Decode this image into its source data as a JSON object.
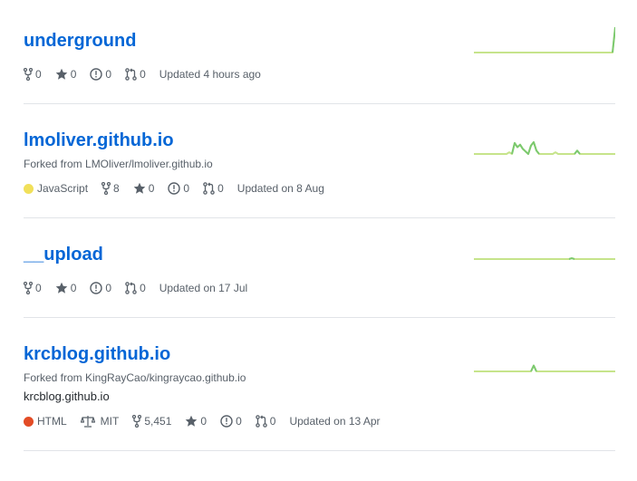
{
  "colors": {
    "link": "#0366d6",
    "text_muted": "#586069",
    "spark_line": "#c6e48b",
    "spark_dark": "#7bc96f",
    "lang_javascript": "#f1e05a",
    "lang_html": "#e34c26"
  },
  "repos": [
    {
      "name": "underground",
      "forks": "0",
      "stars": "0",
      "issues": "0",
      "pulls": "0",
      "updated": "Updated 4 hours ago",
      "activity": [
        0,
        0,
        0,
        0,
        0,
        0,
        0,
        0,
        0,
        0,
        0,
        0,
        0,
        0,
        0,
        0,
        0,
        0,
        0,
        0,
        0,
        0,
        0,
        0,
        0,
        0,
        0,
        0,
        0,
        0,
        0,
        0,
        0,
        0,
        0,
        0,
        0,
        0,
        0,
        0,
        0,
        0,
        0,
        0,
        0,
        0,
        0,
        0,
        0,
        0,
        0,
        0,
        30
      ]
    },
    {
      "name": "lmoliver.github.io",
      "forked_from": "Forked from LMOliver/lmoliver.github.io",
      "language": "JavaScript",
      "forks": "8",
      "stars": "0",
      "issues": "0",
      "pulls": "0",
      "updated": "Updated on 8 Aug",
      "activity": [
        0,
        0,
        0,
        0,
        0,
        0,
        0,
        0,
        0,
        0,
        0,
        0,
        0,
        2,
        0,
        13,
        8,
        11,
        6,
        3,
        0,
        10,
        14,
        4,
        0,
        0,
        0,
        0,
        0,
        0,
        2,
        0,
        0,
        0,
        0,
        0,
        0,
        0,
        4,
        0,
        0,
        0,
        0,
        0,
        0,
        0,
        0,
        0,
        0,
        0,
        0,
        0,
        0
      ]
    },
    {
      "name": "__upload",
      "forks": "0",
      "stars": "0",
      "issues": "0",
      "pulls": "0",
      "updated": "Updated on 17 Jul",
      "activity": [
        0,
        0,
        0,
        0,
        0,
        0,
        0,
        0,
        0,
        0,
        0,
        0,
        0,
        0,
        0,
        0,
        0,
        0,
        0,
        0,
        0,
        0,
        0,
        0,
        0,
        0,
        0,
        0,
        0,
        0,
        0,
        0,
        0,
        0,
        0,
        0,
        1,
        0,
        0,
        0,
        0,
        0,
        0,
        0,
        0,
        0,
        0,
        0,
        0,
        0,
        0,
        0,
        0
      ]
    },
    {
      "name": "krcblog.github.io",
      "forked_from": "Forked from KingRayCao/kingraycao.github.io",
      "description": "krcblog.github.io",
      "language": "HTML",
      "license": "MIT",
      "forks": "5,451",
      "stars": "0",
      "issues": "0",
      "pulls": "0",
      "updated": "Updated on 13 Apr",
      "activity": [
        0,
        0,
        0,
        0,
        0,
        0,
        0,
        0,
        0,
        0,
        0,
        0,
        0,
        0,
        0,
        0,
        0,
        0,
        0,
        0,
        0,
        0,
        7,
        0,
        0,
        0,
        0,
        0,
        0,
        0,
        0,
        0,
        0,
        0,
        0,
        0,
        0,
        0,
        0,
        0,
        0,
        0,
        0,
        0,
        0,
        0,
        0,
        0,
        0,
        0,
        0,
        0,
        0
      ]
    }
  ]
}
